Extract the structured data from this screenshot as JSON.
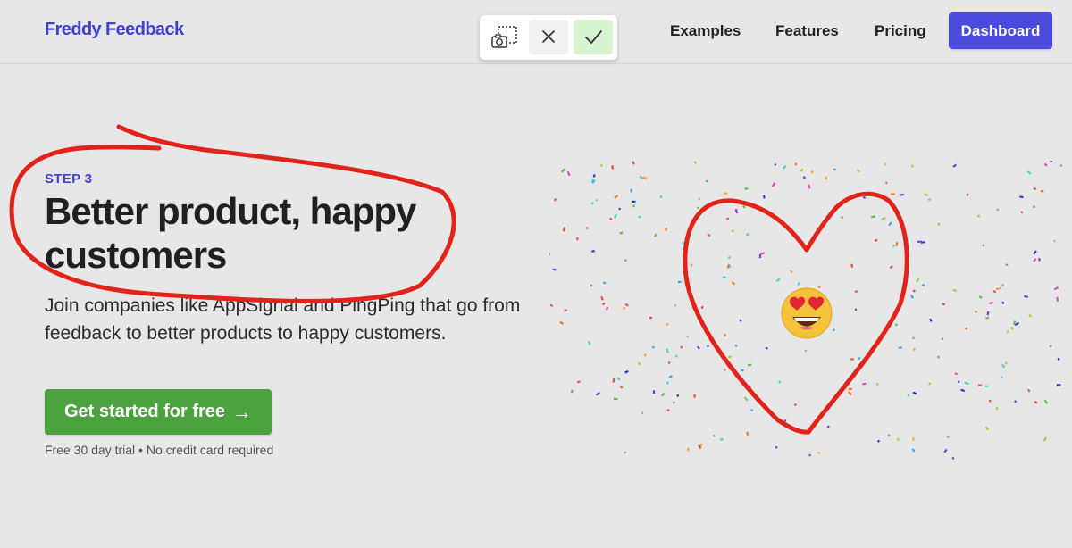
{
  "brand": {
    "name": "Freddy Feedback"
  },
  "nav": {
    "items": [
      {
        "label": "Examples"
      },
      {
        "label": "Features"
      },
      {
        "label": "Pricing"
      }
    ],
    "dashboard_label": "Dashboard",
    "dashboard_color": "#4a4adf"
  },
  "capture_toolbar": {
    "buttons": [
      {
        "icon": "screenshot-region-icon"
      },
      {
        "icon": "close-icon"
      },
      {
        "icon": "checkmark-icon"
      }
    ]
  },
  "hero": {
    "step": "STEP 3",
    "headline": "Better product, happy customers",
    "subtext": "Join companies like AppSignal and PingPing that go from feedback to better products to happy customers.",
    "cta_label": "Get started for free",
    "cta_color": "#4ca23f",
    "fineprint": "Free 30 day trial • No credit card required"
  },
  "illustration": {
    "emoji": "heart-eyes-emoji",
    "annotation_color": "#e2231a"
  }
}
